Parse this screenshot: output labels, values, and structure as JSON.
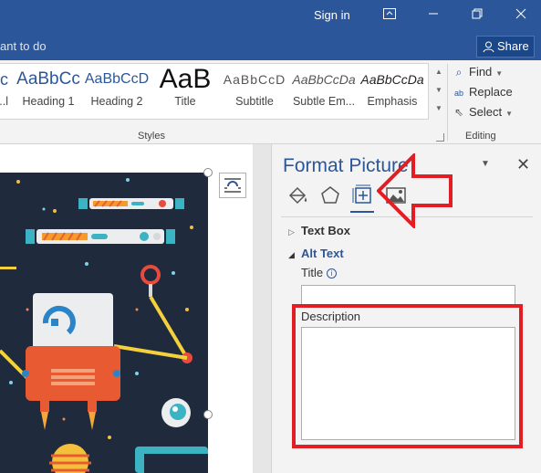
{
  "titlebar": {
    "signin": "Sign in"
  },
  "tellbar": {
    "tell_me": "ant to do",
    "share": "Share"
  },
  "ribbon": {
    "styles": [
      {
        "preview": "...c",
        "label": "...l"
      },
      {
        "preview": "AaBbCc",
        "label": "Heading 1"
      },
      {
        "preview": "AaBbCcD",
        "label": "Heading 2"
      },
      {
        "preview": "AaB",
        "label": "Title"
      },
      {
        "preview": "AaBbCcD",
        "label": "Subtitle"
      },
      {
        "preview": "AaBbCcDa",
        "label": "Subtle Em..."
      },
      {
        "preview": "AaBbCcDa",
        "label": "Emphasis"
      }
    ],
    "styles_group": "Styles",
    "editing": {
      "find": "Find",
      "replace": "Replace",
      "select": "Select",
      "group": "Editing"
    }
  },
  "pane": {
    "title": "Format Picture",
    "sections": {
      "text_box": "Text Box",
      "alt_text": "Alt Text"
    },
    "fields": {
      "title_label": "Title",
      "description_label": "Description",
      "title_value": "",
      "description_value": ""
    }
  },
  "colors": {
    "accent": "#2b579a",
    "highlight": "#e21d24"
  }
}
